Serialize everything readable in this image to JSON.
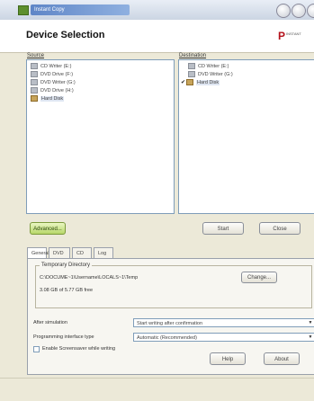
{
  "window": {
    "title": "Instant Copy"
  },
  "header": {
    "title": "Device Selection",
    "logo_letter": "P",
    "logo_text": "INSTANT"
  },
  "source": {
    "label": "Source",
    "items": [
      {
        "label": "CD Writer (E:)",
        "icon": "cd-drive-icon"
      },
      {
        "label": "DVD Drive (F:)",
        "icon": "dvd-drive-icon"
      },
      {
        "label": "DVD Writer (G:)",
        "icon": "dvd-drive-icon"
      },
      {
        "label": "DVD Drive (H:)",
        "icon": "dvd-drive-icon"
      },
      {
        "label": "Hard Disk",
        "icon": "hard-disk-icon",
        "selected": true
      }
    ]
  },
  "destination": {
    "label": "Destination",
    "items": [
      {
        "label": "CD Writer (E:)",
        "icon": "cd-drive-icon",
        "checked": false
      },
      {
        "label": "DVD Writer (G:)",
        "icon": "dvd-drive-icon",
        "checked": false
      },
      {
        "label": "Hard Disk",
        "icon": "hard-disk-icon",
        "checked": true,
        "selected": true
      }
    ]
  },
  "buttons": {
    "advanced": "Advanced...",
    "start": "Start",
    "close": "Close",
    "change": "Change...",
    "help": "Help",
    "about": "About"
  },
  "tabs": [
    "General",
    "DVD",
    "CD",
    "Log"
  ],
  "general": {
    "temp_title": "Temporary Directory",
    "temp_path": "C:\\DOCUME~1\\Username\\LOCALS~1\\Temp",
    "temp_free": "3.08 GB of 5.77 GB free",
    "after_label": "After simulation",
    "after_value": "Start writing after confirmation",
    "iface_label": "Programming interface type",
    "iface_value": "Automatic (Recommended)",
    "enable_label": "Enable Screensaver while writing"
  },
  "colors": {
    "accent": "#b4121b",
    "title_gradient": "#5f86c7",
    "advanced_green": "#b7d769"
  }
}
